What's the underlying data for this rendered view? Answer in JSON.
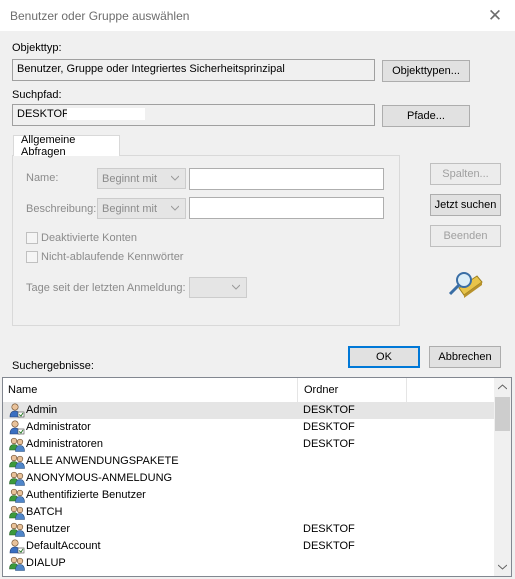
{
  "window": {
    "title": "Benutzer oder Gruppe auswählen",
    "close_glyph": "✕"
  },
  "object_type": {
    "label": "Objekttyp:",
    "value": "Benutzer, Gruppe oder Integriertes Sicherheitsprinzipal",
    "button": "Objekttypen..."
  },
  "search_path": {
    "label": "Suchpfad:",
    "value": "DESKTOF",
    "button": "Pfade..."
  },
  "tabs": [
    {
      "label": "Allgemeine Abfragen"
    }
  ],
  "query": {
    "name_label": "Name:",
    "name_mode": "Beginnt mit",
    "description_label": "Beschreibung:",
    "description_mode": "Beginnt mit",
    "disabled_accounts": "Deaktivierte Konten",
    "non_expiring_passwords": "Nicht-ablaufende Kennwörter",
    "days_since_login": "Tage seit der letzten Anmeldung:"
  },
  "side_buttons": {
    "columns": "Spalten...",
    "search_now": "Jetzt suchen",
    "stop": "Beenden"
  },
  "dialog_buttons": {
    "ok": "OK",
    "cancel": "Abbrechen"
  },
  "results": {
    "label": "Suchergebnisse:",
    "columns": [
      "Name",
      "Ordner"
    ],
    "rows": [
      {
        "name": "Admin",
        "folder": "DESKTOF",
        "icon": "user-icon"
      },
      {
        "name": "Administrator",
        "folder": "DESKTOF",
        "icon": "user-icon"
      },
      {
        "name": "Administratoren",
        "folder": "DESKTOF",
        "icon": "group-icon"
      },
      {
        "name": "ALLE ANWENDUNGSPAKETE",
        "folder": "",
        "icon": "group-icon"
      },
      {
        "name": "ANONYMOUS-ANMELDUNG",
        "folder": "",
        "icon": "group-icon"
      },
      {
        "name": "Authentifizierte Benutzer",
        "folder": "",
        "icon": "group-icon"
      },
      {
        "name": "BATCH",
        "folder": "",
        "icon": "group-icon"
      },
      {
        "name": "Benutzer",
        "folder": "DESKTOF",
        "icon": "group-icon"
      },
      {
        "name": "DefaultAccount",
        "folder": "DESKTOF",
        "icon": "user-icon"
      },
      {
        "name": "DIALUP",
        "folder": "",
        "icon": "group-icon"
      }
    ]
  },
  "colors": {
    "accent": "#0078d7",
    "window_bg": "#f0f0f0",
    "selection": "#e5e5e5"
  }
}
